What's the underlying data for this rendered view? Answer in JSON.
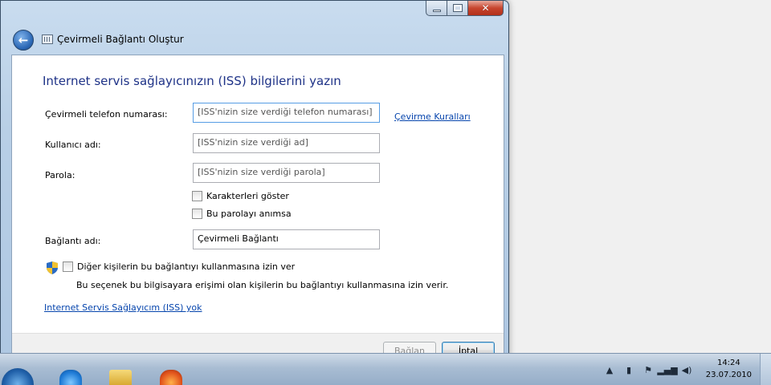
{
  "window": {
    "title": "Çevirmeli Bağlantı Oluştur",
    "heading": "Internet servis sağlayıcınızın (ISS) bilgilerini yazın"
  },
  "form": {
    "phone": {
      "label": "Çevirmeli telefon numarası:",
      "placeholder": "[ISS'nizin size verdiği telefon numarası]"
    },
    "dialing_rules_link": "Çevirme Kuralları",
    "username": {
      "label": "Kullanıcı adı:",
      "placeholder": "[ISS'nizin size verdiği ad]"
    },
    "password": {
      "label": "Parola:",
      "placeholder": "[ISS'nizin size verdiği parola]"
    },
    "show_chars": {
      "label": "Karakterleri göster",
      "checked": false
    },
    "remember_pw": {
      "label": "Bu parolayı anımsa",
      "checked": false
    },
    "connection_name": {
      "label": "Bağlantı adı:",
      "value": "Çevirmeli Bağlantı"
    },
    "allow_others": {
      "label": "Diğer kişilerin bu bağlantıyı kullanmasına izin ver",
      "checked": false
    },
    "allow_others_note": "Bu seçenek bu bilgisayara erişimi olan kişilerin bu bağlantıyı kullanmasına izin verir.",
    "no_isp_link": "Internet Servis Sağlayıcım (ISS) yok"
  },
  "buttons": {
    "connect": "Bağlan",
    "cancel": "İptal"
  },
  "taskbar": {
    "time": "14:24",
    "date": "23.07.2010"
  }
}
